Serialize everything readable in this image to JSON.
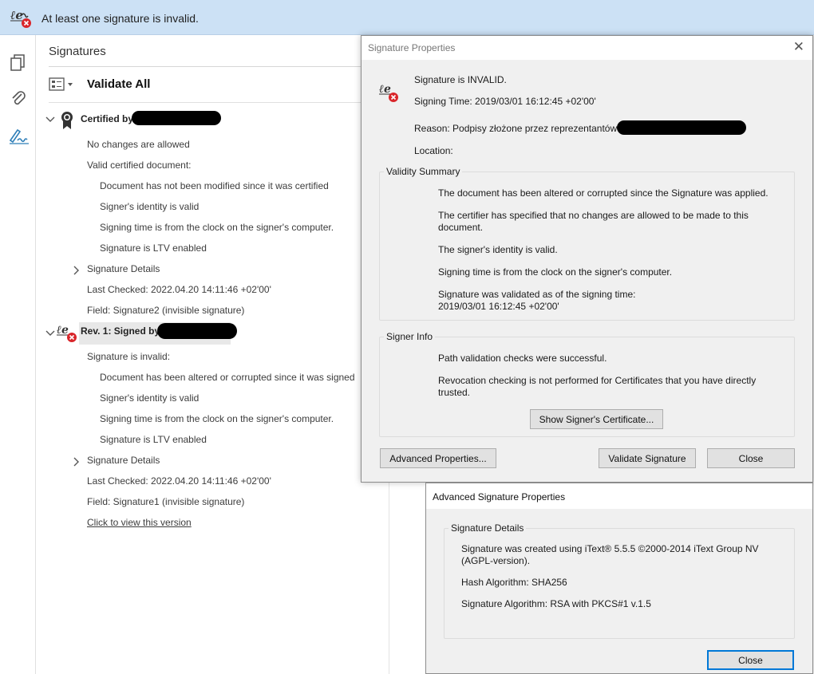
{
  "banner": {
    "text": "At least one signature is invalid.",
    "icon": "invalid-signature-icon"
  },
  "toolbar": {
    "items": [
      "pages-icon",
      "attachment-icon",
      "signature-pen-icon"
    ]
  },
  "panel": {
    "title": "Signatures",
    "validate_all": "Validate All",
    "sig1": {
      "header": "Certified by",
      "lines": [
        "No changes are allowed",
        "Valid certified document:",
        "Document has not been modified since it was certified",
        "Signer's identity is valid",
        "Signing time is from the clock on the signer's computer.",
        "Signature is LTV enabled",
        "Signature Details",
        "Last Checked: 2022.04.20 14:11:46 +02'00'",
        "Field: Signature2 (invisible signature)"
      ]
    },
    "sig2": {
      "header": "Rev. 1: Signed by",
      "lines": [
        "Signature is invalid:",
        "Document has been altered or corrupted since it was signed",
        "Signer's identity is valid",
        "Signing time is from the clock on the signer's computer.",
        "Signature is LTV enabled",
        "Signature Details",
        "Last Checked: 2022.04.20 14:11:46 +02'00'",
        "Field: Signature1 (invisible signature)"
      ],
      "link": "Click to view this version"
    }
  },
  "sig_props": {
    "title": "Signature Properties",
    "status": "Signature is INVALID.",
    "signing_time": "Signing Time:  2019/03/01 16:12:45 +02'00'",
    "reason": "Reason:  Podpisy złożone przez reprezentantów",
    "location": "Location:",
    "validity_summary": {
      "label": "Validity Summary",
      "lines": [
        "The document has been altered or corrupted since the Signature was applied.",
        "The certifier has specified that no changes are allowed to be made to this document.",
        "The signer's identity is valid.",
        "Signing time is from the clock on the signer's computer.",
        "Signature was validated as of the signing time:",
        "2019/03/01 16:12:45 +02'00'"
      ]
    },
    "signer_info": {
      "label": "Signer Info",
      "lines": [
        "Path validation checks were successful.",
        "Revocation checking is not performed for Certificates that you have directly trusted."
      ],
      "show_cert": "Show Signer's Certificate..."
    },
    "buttons": {
      "advanced": "Advanced Properties...",
      "validate": "Validate Signature",
      "close": "Close"
    }
  },
  "adv_props": {
    "title": "Advanced Signature Properties",
    "group_label": "Signature Details",
    "lines": [
      "Signature was created using iText® 5.5.5 ©2000-2014 iText Group NV (AGPL-version).",
      "Hash Algorithm: SHA256",
      "Signature Algorithm: RSA with PKCS#1 v.1.5"
    ],
    "close": "Close"
  },
  "colors": {
    "banner_bg": "#cce1f5",
    "invalid_red": "#d9252a",
    "accent_blue": "#0078d7"
  }
}
